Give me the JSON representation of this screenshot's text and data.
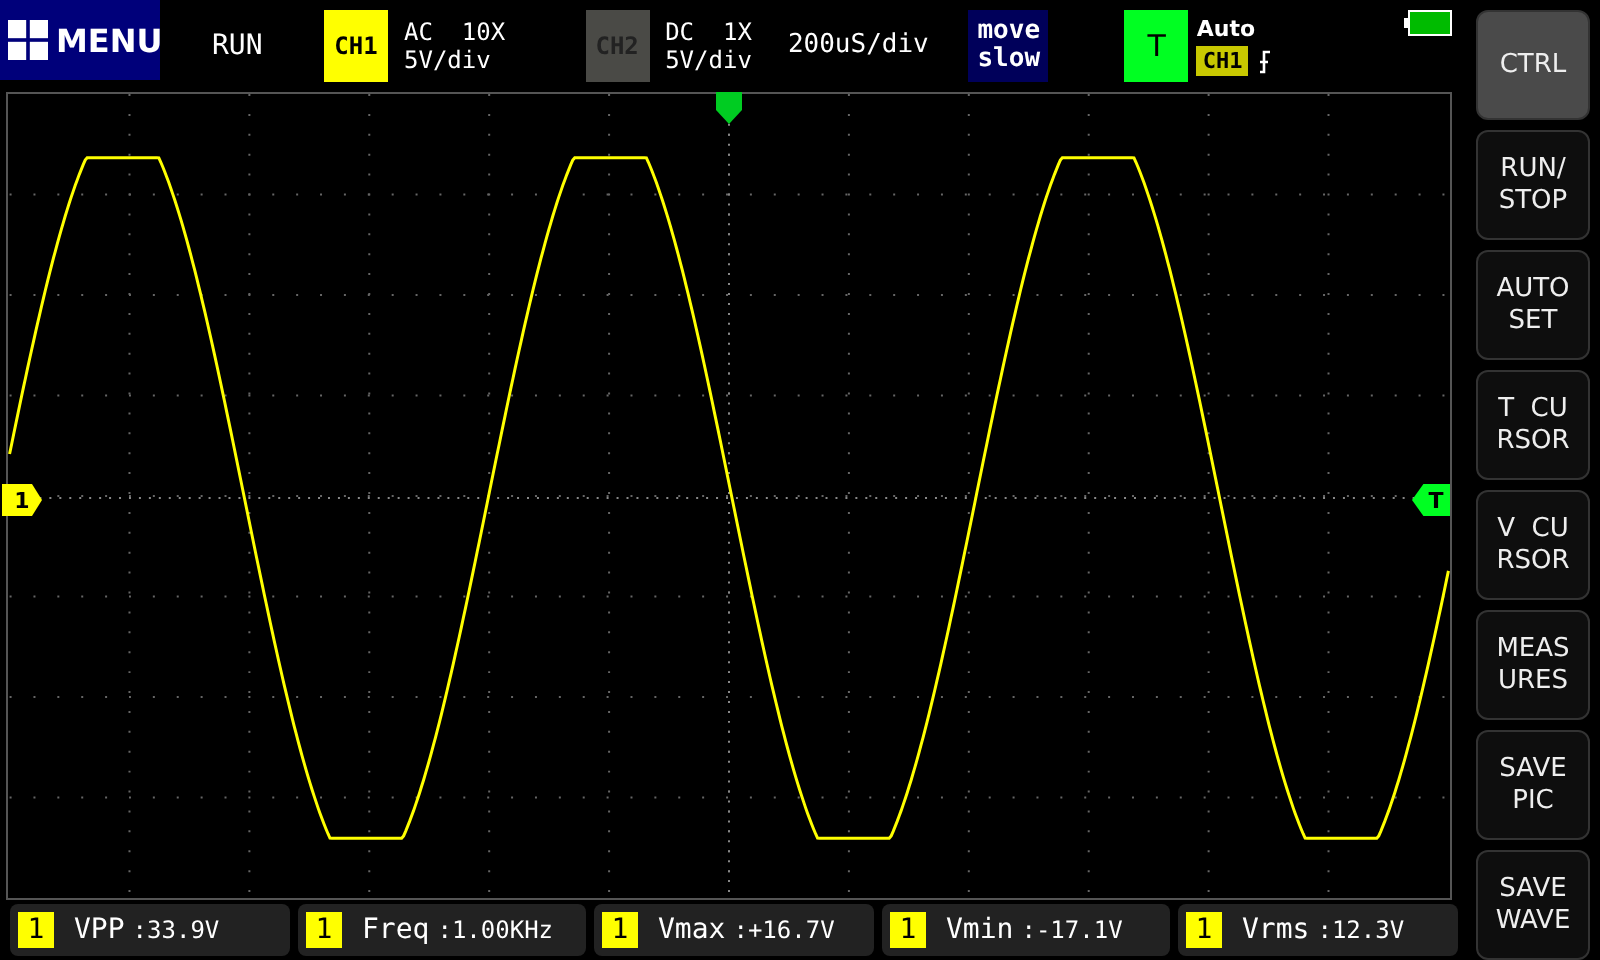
{
  "top_bar": {
    "menu": "MENU",
    "run_state": "RUN",
    "channels": [
      {
        "label": "CH1",
        "coupling": "AC  10X",
        "scale": "5V/div",
        "enabled": true
      },
      {
        "label": "CH2",
        "coupling": "DC  1X",
        "scale": "5V/div",
        "enabled": false
      }
    ],
    "timebase": "200uS/div",
    "move_speed": "move\nslow",
    "trigger": {
      "label": "T",
      "mode": "Auto",
      "source": "CH1"
    }
  },
  "plot": {
    "channel_marker": "1",
    "trigger_marker": "T"
  },
  "measurements": [
    {
      "channel": "1",
      "name": "VPP",
      "value": ":33.9V"
    },
    {
      "channel": "1",
      "name": "Freq",
      "value": ":1.00KHz"
    },
    {
      "channel": "1",
      "name": "Vmax",
      "value": ":+16.7V"
    },
    {
      "channel": "1",
      "name": "Vmin",
      "value": ":-17.1V"
    },
    {
      "channel": "1",
      "name": "Vrms",
      "value": ":12.3V"
    }
  ],
  "side_buttons": [
    {
      "label": "CTRL",
      "selected": true
    },
    {
      "label": "RUN/\nSTOP",
      "selected": false
    },
    {
      "label": "AUTO\nSET",
      "selected": false
    },
    {
      "label": "T  CU\nRSOR",
      "selected": false
    },
    {
      "label": "V  CU\nRSOR",
      "selected": false
    },
    {
      "label": "MEAS\nURES",
      "selected": false
    },
    {
      "label": "SAVE\nPIC",
      "selected": false
    },
    {
      "label": "SAVE\nWAVE",
      "selected": false
    }
  ]
}
